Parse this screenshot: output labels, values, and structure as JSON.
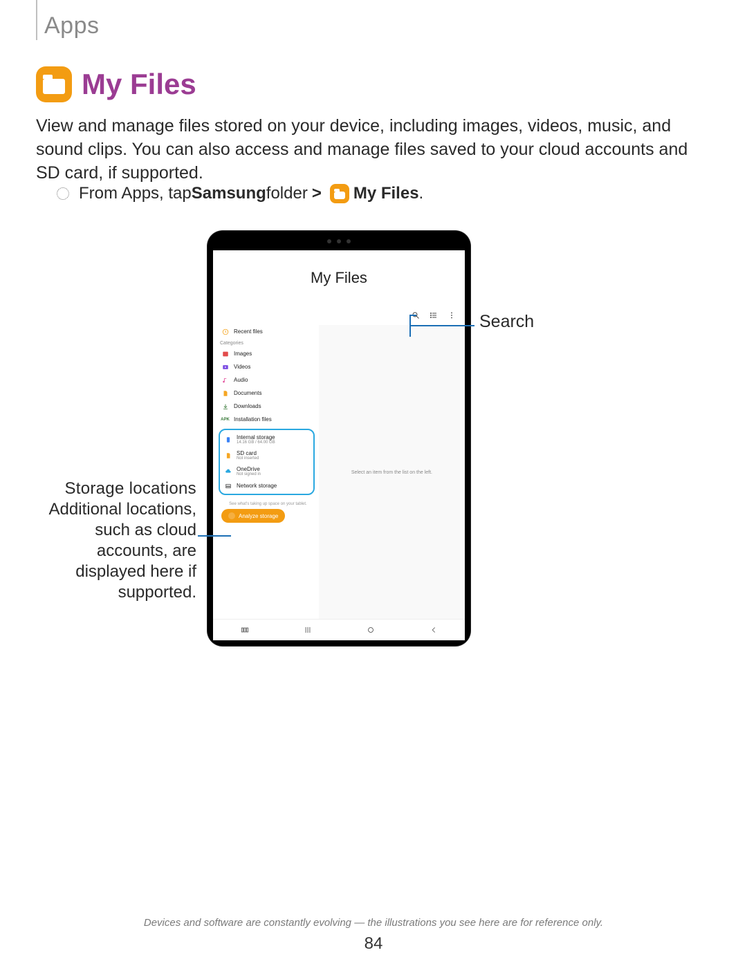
{
  "header": {
    "breadcrumb": "Apps"
  },
  "section": {
    "title": "My Files",
    "description": "View and manage files stored on your device, including images, videos, music, and sound clips. You can also access and manage files saved to your cloud accounts and SD card, if supported."
  },
  "instruction": {
    "prefix": "From Apps, tap ",
    "bold1": "Samsung",
    "mid": " folder ",
    "chevron": ">",
    "bold2": "My Files",
    "suffix": "."
  },
  "tablet": {
    "screen_title": "My Files",
    "toolbar_icons": [
      "search",
      "list",
      "more"
    ],
    "left": {
      "recent": "Recent files",
      "categories_header": "Categories",
      "categories": [
        {
          "icon": "images",
          "label": "Images"
        },
        {
          "icon": "videos",
          "label": "Videos"
        },
        {
          "icon": "audio",
          "label": "Audio"
        },
        {
          "icon": "documents",
          "label": "Documents"
        },
        {
          "icon": "downloads",
          "label": "Downloads"
        },
        {
          "icon": "apk",
          "label": "Installation files"
        }
      ],
      "storage": [
        {
          "icon": "internal",
          "label": "Internal storage",
          "sub": "14.16 GB / 64.00 GB"
        },
        {
          "icon": "sd",
          "label": "SD card",
          "sub": "Not inserted"
        },
        {
          "icon": "onedrive",
          "label": "OneDrive",
          "sub": "Not signed in"
        },
        {
          "icon": "network",
          "label": "Network storage",
          "sub": ""
        }
      ],
      "analyze_caption": "See what's taking up space on your tablet.",
      "analyze_button": "Analyze storage"
    },
    "right_placeholder": "Select an item from the list on the left."
  },
  "callouts": {
    "search": "Search",
    "storage_head": "Storage locations",
    "storage_body": "Additional locations, such as cloud accounts, are displayed here if supported."
  },
  "footer": "Devices and software are constantly evolving — the illustrations you see here are for reference only.",
  "page_number": "84"
}
